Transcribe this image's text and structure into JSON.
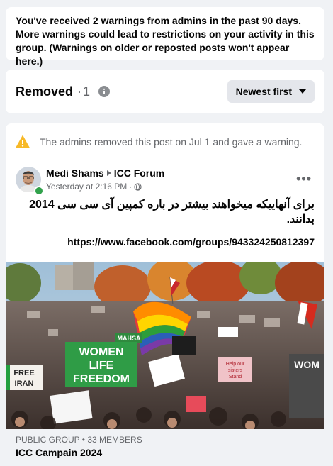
{
  "warning": {
    "text": "You've received 2 warnings from admins in the past 90 days. More warnings could lead to restrictions on your activity in this group. (Warnings on older or reposted posts won't appear here.)"
  },
  "removed_section": {
    "label": "Removed",
    "separator": "·",
    "count": "1",
    "sort_label": "Newest first"
  },
  "post": {
    "notice": "The admins removed this post on Jul 1 and gave a warning.",
    "author": "Medi Shams",
    "group": "ICC Forum",
    "timestamp": "Yesterday at 2:16 PM",
    "audience_separator": "·",
    "more_label": "•••",
    "text": "برای آنهاییکه میخواهند بیشتر در باره کمپین آی سی سی 2014 بدانند.",
    "link": "https://www.facebook.com/groups/943324250812397",
    "image_signs": {
      "women_life_freedom": [
        "WOMEN",
        "LIFE",
        "FREEDOM"
      ],
      "mahsa": "MAHSA",
      "free_iran": [
        "FREE",
        "IRAN"
      ],
      "help_sisters": [
        "Help our",
        "sisters",
        "Stand"
      ],
      "wom": "WOM"
    },
    "preview": {
      "subtitle": "PUBLIC GROUP • 33 MEMBERS",
      "title": "ICC Campain 2024"
    }
  },
  "colors": {
    "page_bg": "#f0f2f5",
    "card_bg": "#ffffff",
    "secondary_text": "#65676b",
    "warning_icon": "#f7b928",
    "online": "#31a24c"
  },
  "icons": {
    "info": "info-icon",
    "sort_caret": "caret-down-icon",
    "notice": "warning-icon",
    "group_arrow": "triangle-right-icon",
    "audience": "globe-icon",
    "more": "more-icon"
  }
}
